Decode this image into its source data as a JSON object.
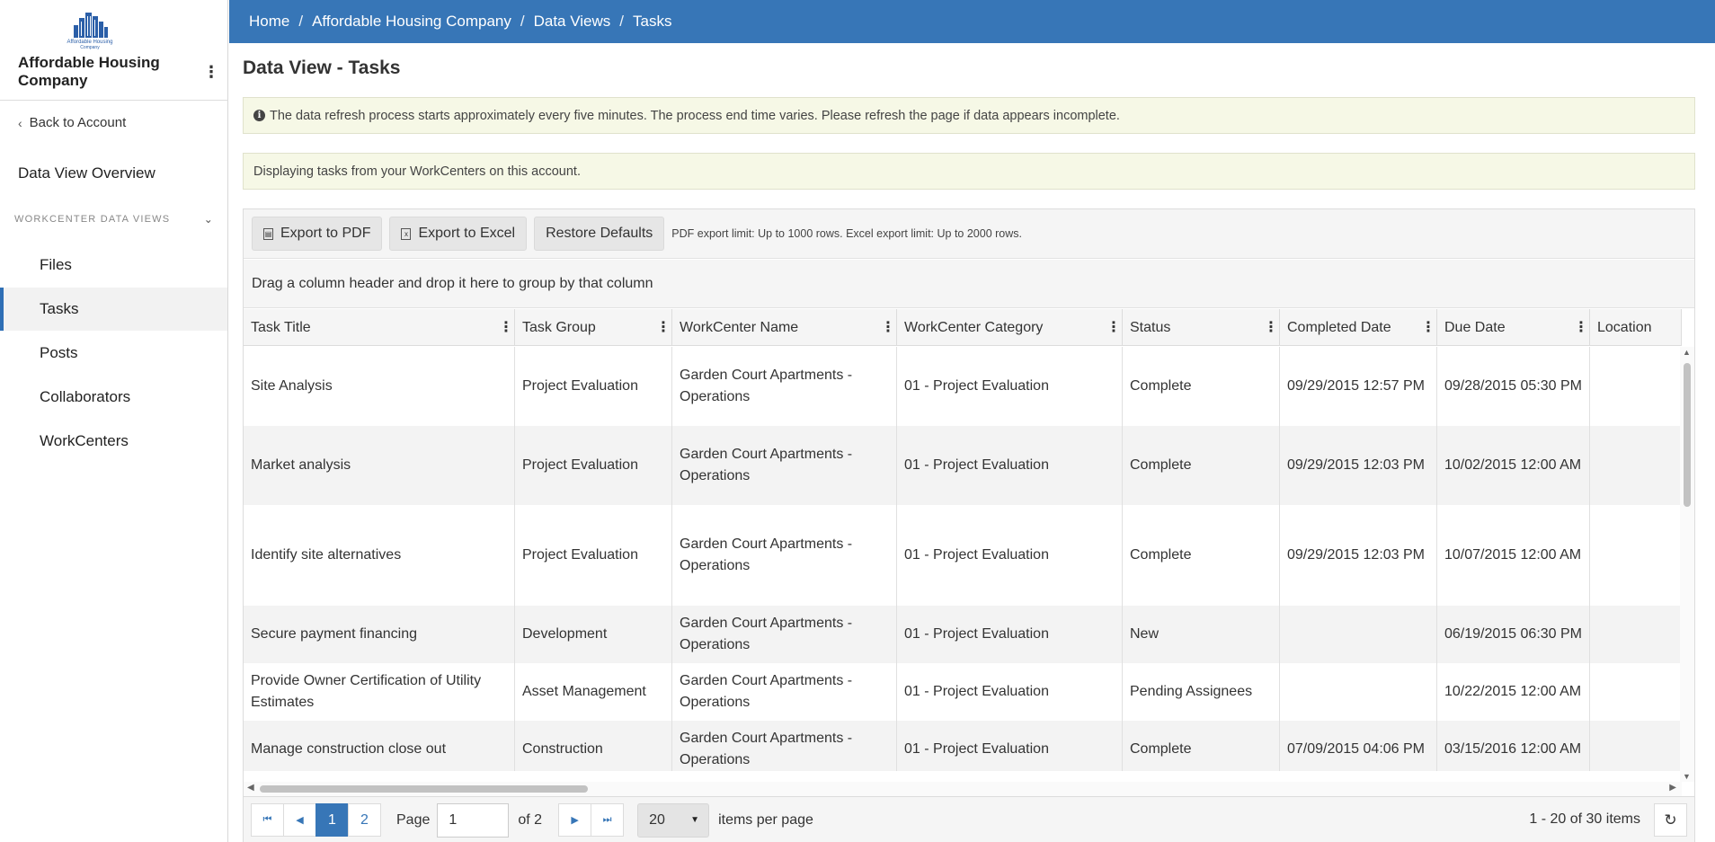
{
  "sidebar": {
    "logo_text": "Affordable Housing Company",
    "org_name": "Affordable Housing Company",
    "back_label": "Back to Account",
    "overview_label": "Data View Overview",
    "section_label": "WORKCENTER DATA VIEWS",
    "items": [
      {
        "label": "Files",
        "active": false
      },
      {
        "label": "Tasks",
        "active": true
      },
      {
        "label": "Posts",
        "active": false
      },
      {
        "label": "Collaborators",
        "active": false
      },
      {
        "label": "WorkCenters",
        "active": false
      }
    ]
  },
  "breadcrumb": [
    "Home",
    "Affordable Housing Company",
    "Data Views",
    "Tasks"
  ],
  "page_title": "Data View - Tasks",
  "alerts": {
    "refresh_notice": "The data refresh process starts approximately every five minutes. The process end time varies. Please refresh the page if data appears incomplete.",
    "scope_notice": "Displaying tasks from your WorkCenters on this account."
  },
  "toolbar": {
    "export_pdf": "Export to PDF",
    "export_excel": "Export to Excel",
    "restore_defaults": "Restore Defaults",
    "export_note": "PDF export limit: Up to 1000 rows. Excel export limit: Up to 2000 rows."
  },
  "group_hint": "Drag a column header and drop it here to group by that column",
  "columns": [
    "Task Title",
    "Task Group",
    "WorkCenter Name",
    "WorkCenter Category",
    "Status",
    "Completed Date",
    "Due Date",
    "Location"
  ],
  "rows": [
    [
      "Site Analysis",
      "Project Evaluation",
      "Garden Court Apartments - Operations",
      "01 - Project Evaluation",
      "Complete",
      "09/29/2015 12:57 PM",
      "09/28/2015 05:30 PM",
      ""
    ],
    [
      "Market analysis",
      "Project Evaluation",
      "Garden Court Apartments - Operations",
      "01 - Project Evaluation",
      "Complete",
      "09/29/2015 12:03 PM",
      "10/02/2015 12:00 AM",
      ""
    ],
    [
      "Identify site alternatives",
      "Project Evaluation",
      "Garden Court Apartments - Operations",
      "01 - Project Evaluation",
      "Complete",
      "09/29/2015 12:03 PM",
      "10/07/2015 12:00 AM",
      ""
    ],
    [
      "Secure payment financing",
      "Development",
      "Garden Court Apartments - Operations",
      "01 - Project Evaluation",
      "New",
      "",
      "06/19/2015 06:30 PM",
      ""
    ],
    [
      "Provide Owner Certification of Utility Estimates",
      "Asset Management",
      "Garden Court Apartments - Operations",
      "01 - Project Evaluation",
      "Pending Assignees",
      "",
      "10/22/2015 12:00 AM",
      ""
    ],
    [
      "Manage construction close out",
      "Construction",
      "Garden Court Apartments - Operations",
      "01 - Project Evaluation",
      "Complete",
      "07/09/2015 04:06 PM",
      "03/15/2016 12:00 AM",
      ""
    ]
  ],
  "pager": {
    "pages": [
      "1",
      "2"
    ],
    "current_page": "1",
    "page_label": "Page",
    "page_input_value": "1",
    "of_label": "of 2",
    "page_size": "20",
    "items_per_page_label": "items per page",
    "range_text": "1 - 20 of 30 items"
  },
  "colors": {
    "brand_blue": "#3776b7",
    "alert_bg": "#f6f8e6",
    "row_alt": "#f3f3f3"
  }
}
